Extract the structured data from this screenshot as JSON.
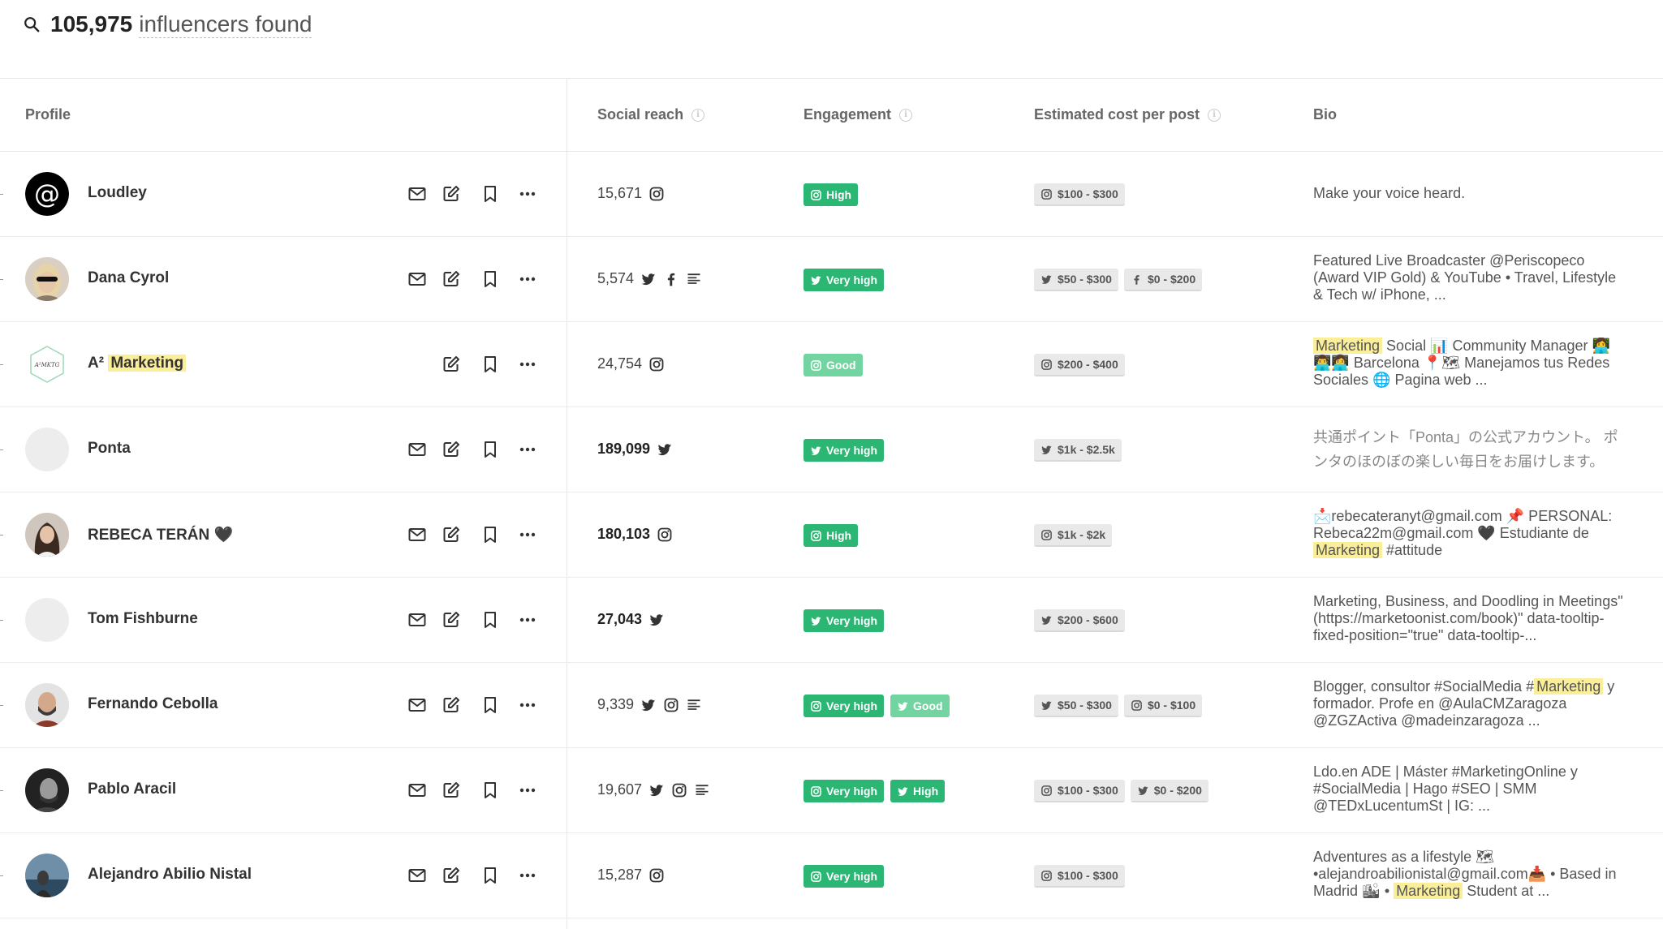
{
  "search": {
    "count": "105,975",
    "suffix": "influencers found"
  },
  "columns": {
    "profile": "Profile",
    "reach": "Social reach",
    "engagement": "Engagement",
    "cost": "Estimated cost per post",
    "bio": "Bio"
  },
  "colors": {
    "engagement_green": "#2bb673",
    "engagement_light": "#72d4a0",
    "highlight": "#fbee99"
  },
  "rows": [
    {
      "name": "Loudley",
      "reach": "15,671",
      "reach_platforms": [
        "instagram"
      ],
      "engagement": [
        {
          "platform": "instagram",
          "label": "High"
        }
      ],
      "costs": [
        {
          "platform": "instagram",
          "label": "$100 - $300"
        }
      ],
      "bio": "Make your voice heard."
    },
    {
      "name": "Dana Cyrol",
      "reach": "5,574",
      "reach_platforms": [
        "twitter",
        "facebook",
        "blog"
      ],
      "engagement": [
        {
          "platform": "twitter",
          "label": "Very high"
        }
      ],
      "costs": [
        {
          "platform": "twitter",
          "label": "$50 - $300"
        },
        {
          "platform": "facebook",
          "label": "$0 - $200"
        }
      ],
      "bio": "Featured Live Broadcaster @Periscopeco (Award VIP Gold) & YouTube • Travel, Lifestyle & Tech w/ iPhone, ..."
    },
    {
      "name_prefix": "A²",
      "name_highlight": "Marketing",
      "reach": "24,754",
      "reach_platforms": [
        "instagram"
      ],
      "engagement": [
        {
          "platform": "instagram",
          "label": "Good"
        }
      ],
      "costs": [
        {
          "platform": "instagram",
          "label": "$200 - $400"
        }
      ],
      "bio_highlight": "Marketing",
      "bio_rest": "Social 📊 Community Manager 👩‍💻 👨‍💻👩‍💻 Barcelona 📍🗺 Manejamos tus Redes Sociales 🌐 Pagina web ..."
    },
    {
      "name": "Ponta",
      "reach": "189,099",
      "reach_platforms": [
        "twitter"
      ],
      "engagement": [
        {
          "platform": "twitter",
          "label": "Very high"
        }
      ],
      "costs": [
        {
          "platform": "twitter",
          "label": "$1k - $2.5k"
        }
      ],
      "bio": "共通ポイント「Ponta」の公式アカウント。 ポンタのほのぼの楽しい毎日をお届けします。 Pontaのキャンペーンやおトクな情報もお届けします。"
    },
    {
      "name": "REBECA TERÁN 🖤",
      "reach": "180,103",
      "reach_platforms": [
        "instagram"
      ],
      "engagement": [
        {
          "platform": "instagram",
          "label": "High"
        }
      ],
      "costs": [
        {
          "platform": "instagram",
          "label": "$1k - $2k"
        }
      ],
      "bio_pre": "📩rebecateranyt@gmail.com 📌 PERSONAL: Rebeca22m@gmail.com 🖤 Estudiante de ",
      "bio_highlight": "Marketing",
      "bio_post": " #attitude"
    },
    {
      "name": "Tom Fishburne",
      "reach": "27,043",
      "reach_platforms": [
        "twitter"
      ],
      "engagement": [
        {
          "platform": "twitter",
          "label": "Very high"
        }
      ],
      "costs": [
        {
          "platform": "twitter",
          "label": "$200 - $600"
        }
      ],
      "bio": "Marketing, Business, and Doodling in Meetings\" (https://marketoonist.com/book)\" data-tooltip-fixed-position=\"true\" data-tooltip-..."
    },
    {
      "name": "Fernando Cebolla",
      "reach": "9,339",
      "reach_platforms": [
        "twitter",
        "instagram",
        "blog"
      ],
      "engagement": [
        {
          "platform": "instagram",
          "label": "Very high"
        },
        {
          "platform": "twitter",
          "label": "Good"
        }
      ],
      "costs": [
        {
          "platform": "twitter",
          "label": "$50 - $300"
        },
        {
          "platform": "instagram",
          "label": "$0 - $100"
        }
      ],
      "bio_pre": "Blogger, consultor #SocialMedia #",
      "bio_highlight": "Marketing",
      "bio_post": " y formador. Profe en @AulaCMZaragoza @ZGZActiva @madeinzaragoza ..."
    },
    {
      "name": "Pablo Aracil",
      "reach": "19,607",
      "reach_platforms": [
        "twitter",
        "instagram",
        "blog"
      ],
      "engagement": [
        {
          "platform": "instagram",
          "label": "Very high"
        },
        {
          "platform": "twitter",
          "label": "High"
        }
      ],
      "costs": [
        {
          "platform": "instagram",
          "label": "$100 - $300"
        },
        {
          "platform": "twitter",
          "label": "$0 - $200"
        }
      ],
      "bio": "Ldo.en ADE | Máster #MarketingOnline y #SocialMedia | Hago #SEO | SMM @TEDxLucentumSt | IG: ..."
    },
    {
      "name": "Alejandro Abilio Nistal",
      "reach": "15,287",
      "reach_platforms": [
        "instagram"
      ],
      "engagement": [
        {
          "platform": "instagram",
          "label": "Very high"
        }
      ],
      "costs": [
        {
          "platform": "instagram",
          "label": "$100 - $300"
        }
      ],
      "bio_pre": "Adventures as a lifestyle 🗺 •alejandroabilionistal@gmail.com📥 • Based in Madrid 🏙 • ",
      "bio_highlight": "Marketing",
      "bio_post": " Student at ..."
    }
  ]
}
